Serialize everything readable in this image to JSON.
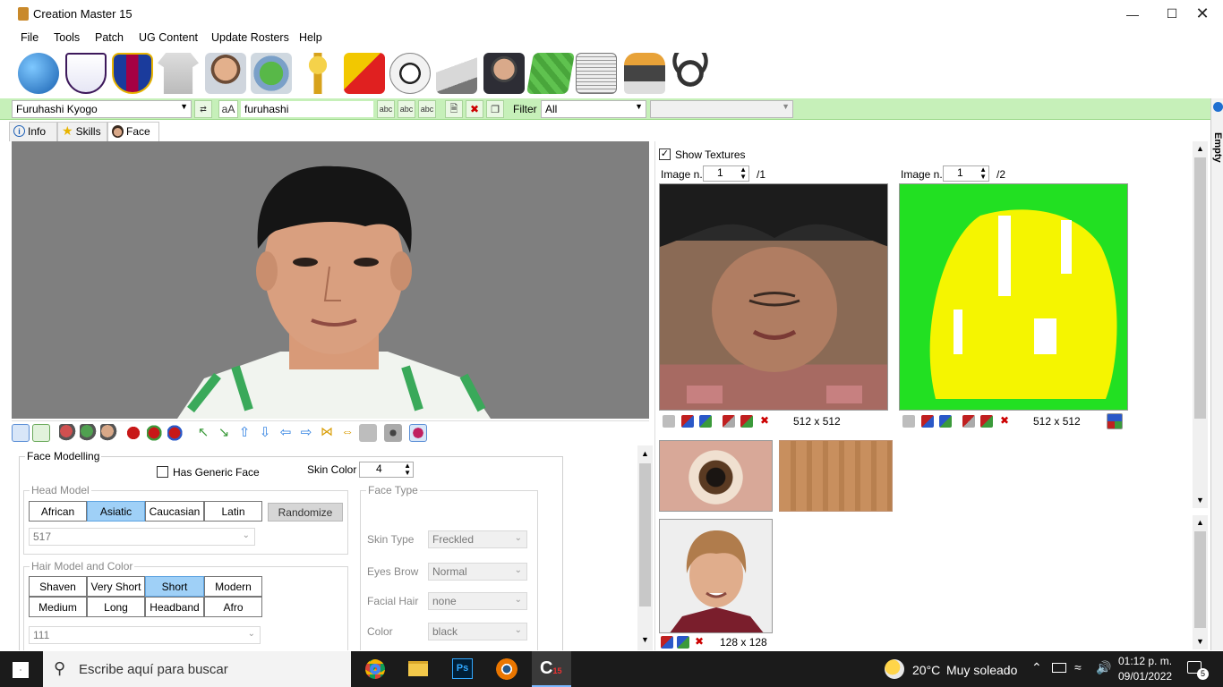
{
  "window": {
    "title": "Creation Master 15",
    "controls": [
      "minimize",
      "maximize",
      "close"
    ]
  },
  "menu": [
    "File",
    "Tools",
    "Patch",
    "UG Content",
    "Update Rosters",
    "Help"
  ],
  "toolbar_icons": [
    "globe-icon",
    "premier-league-icon",
    "barcelona-crest-icon",
    "kit-shirt-icon",
    "player-face-icon",
    "stadium-icon",
    "world-cup-trophy-icon",
    "cards-icon",
    "football-icon",
    "boots-icon",
    "manager-icon",
    "pitch-icon",
    "newspaper-icon",
    "goalkeeper-gloves-icon",
    "headphones-icon"
  ],
  "filterbar": {
    "player_select": "Furuhashi Kyogo",
    "search_mode_label": "aA",
    "search_value": "furuhashi",
    "filter_label": "Filter",
    "filter_value": "All",
    "extra_select": ""
  },
  "side_panel_label": "Empty",
  "tabs": [
    {
      "label": "Info",
      "icon": "info-icon"
    },
    {
      "label": "Skills",
      "icon": "star-icon"
    },
    {
      "label": "Face",
      "icon": "face-icon"
    }
  ],
  "face_modelling": {
    "title": "Face Modelling",
    "generic_face_label": "Has Generic Face",
    "generic_face_checked": false,
    "skin_color_label": "Skin Color",
    "skin_color_value": "4",
    "head_model": {
      "legend": "Head Model",
      "options": [
        "African",
        "Asiatic",
        "Caucasian",
        "Latin"
      ],
      "selected": "Asiatic",
      "randomize_label": "Randomize",
      "model_id": "517"
    },
    "hair": {
      "legend": "Hair Model and Color",
      "options": [
        "Shaven",
        "Very Short",
        "Short",
        "Modern",
        "Medium",
        "Long",
        "Headband",
        "Afro"
      ],
      "selected": "Short",
      "model_id": "111"
    },
    "face_type": {
      "legend": "Face Type",
      "fields": [
        {
          "label": "Skin Type",
          "value": "Freckled"
        },
        {
          "label": "Eyes Brow",
          "value": "Normal"
        },
        {
          "label": "Facial Hair",
          "value": "none"
        },
        {
          "label": "Color",
          "value": "black"
        }
      ]
    }
  },
  "textures": {
    "show_textures_label": "Show Textures",
    "show_textures_checked": true,
    "image_label": "Image n.",
    "left": {
      "image_index": "1",
      "total": "/1",
      "size": "512 x 512"
    },
    "right": {
      "image_index": "1",
      "total": "/2",
      "size": "512 x 512"
    },
    "portrait_size": "128 x 128"
  },
  "taskbar": {
    "search_placeholder": "Escribe aquí para buscar",
    "temperature": "20°C",
    "weather": "Muy soleado",
    "time": "01:12 p. m.",
    "date": "09/01/2022",
    "notifications": "5"
  },
  "colors": {
    "accent_green": "#c6f0b9",
    "selected_blue": "#9fd0f7",
    "taskbar": "#1b1b1b"
  }
}
